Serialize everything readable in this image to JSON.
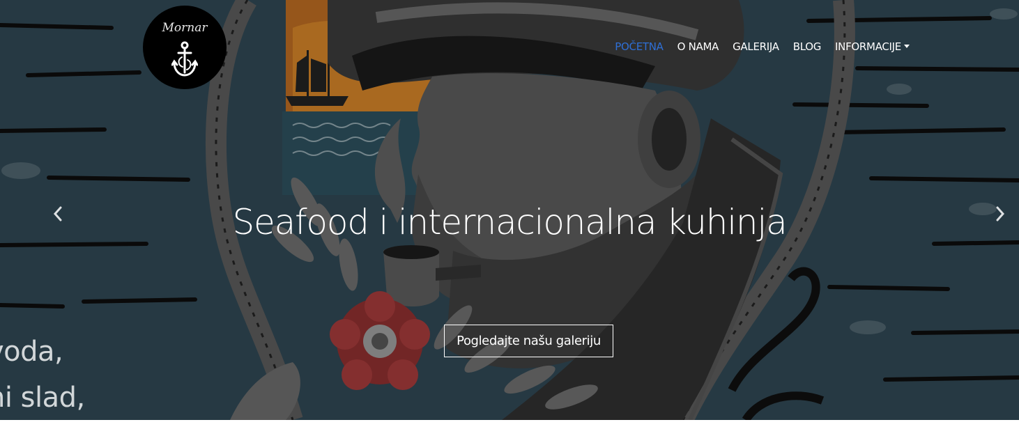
{
  "logo": {
    "name": "Mornar"
  },
  "nav": {
    "items": [
      {
        "label": "POČETNA"
      },
      {
        "label": "O NAMA"
      },
      {
        "label": "GALERIJA"
      },
      {
        "label": "BLOG"
      },
      {
        "label": "INFORMACIJE"
      }
    ]
  },
  "hero": {
    "headline": "Seafood i internacionalna kuhinja",
    "cta_label": "Pogledajte našu galeriju",
    "background_text": [
      "voda,",
      "hi slad,"
    ]
  },
  "colors": {
    "accent": "#2f6fd6",
    "hero_bg": "#2e434f",
    "text": "#ffffff"
  },
  "icons": [
    "anchor-icon",
    "chevron-left-icon",
    "chevron-right-icon",
    "dropdown-caret-icon"
  ]
}
